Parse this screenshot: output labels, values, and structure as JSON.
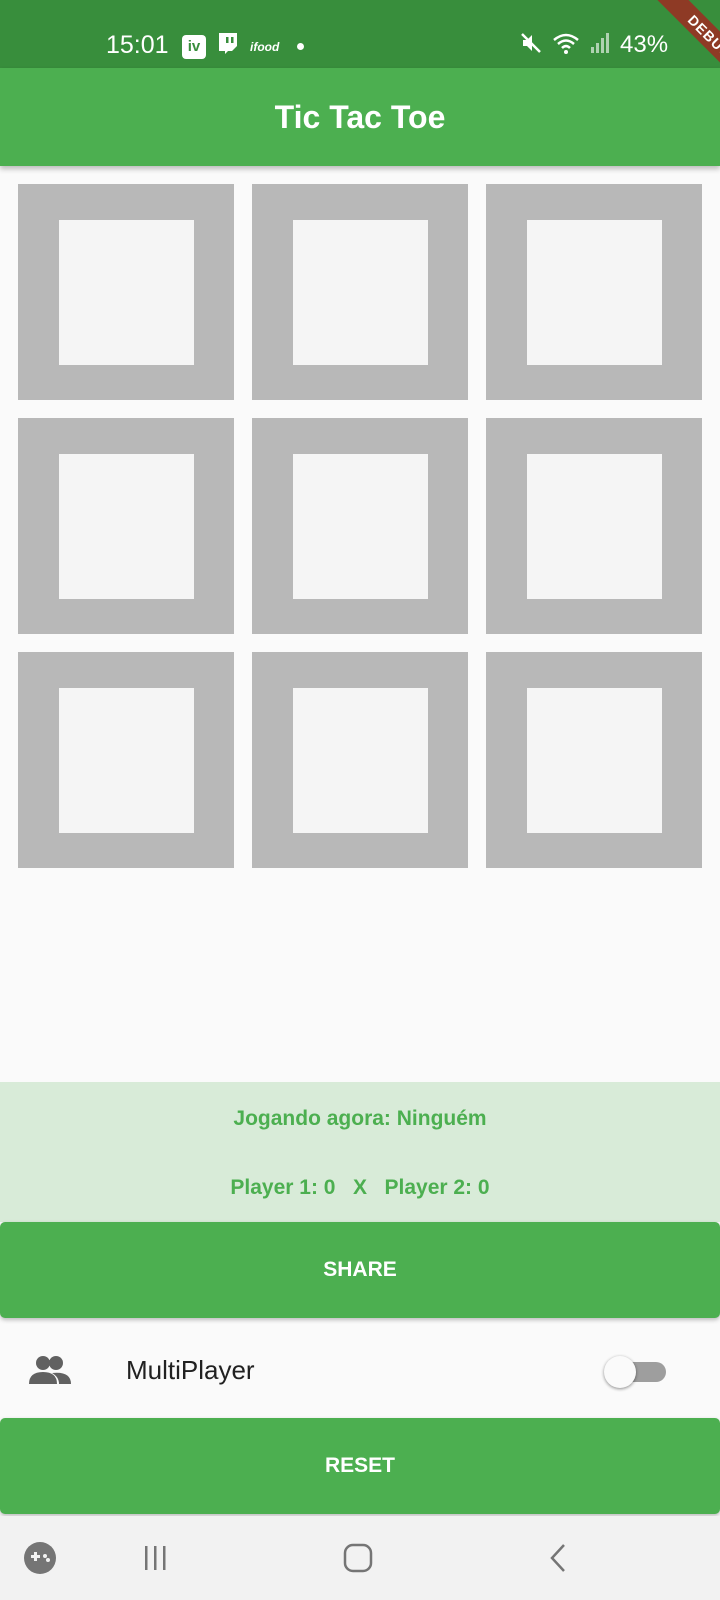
{
  "status_bar": {
    "time": "15:01",
    "app_icons": [
      {
        "icon": "iv-app-icon",
        "text": "iv"
      },
      {
        "icon": "twitch-icon"
      },
      {
        "icon": "ifood-icon",
        "text": "ifood"
      },
      {
        "icon": "notification-dot-icon"
      }
    ],
    "battery": "43%",
    "right_icons": [
      "mute-icon",
      "wifi-icon",
      "signal-icon"
    ]
  },
  "debug_banner": "DEBUG",
  "app_bar": {
    "title": "Tic Tac Toe",
    "color": "#4caf50"
  },
  "board": {
    "cells": [
      "",
      "",
      "",
      "",
      "",
      "",
      "",
      "",
      ""
    ],
    "cell_color": "#b8b8b8",
    "inner_color": "#f5f5f5"
  },
  "game_status": {
    "now_playing": "Jogando agora: Ninguém",
    "score": "Player 1: 0   X   Player 2: 0",
    "text_color": "#4caf50",
    "panel_color": "#d8ebd8"
  },
  "buttons": {
    "share": "SHARE",
    "reset": "RESET"
  },
  "multiplayer": {
    "icon": "people-icon",
    "label": "MultiPlayer",
    "enabled": false
  },
  "nav_bar": {
    "items": [
      "game-launcher-icon",
      "recent-apps-icon",
      "home-icon",
      "back-icon"
    ]
  }
}
